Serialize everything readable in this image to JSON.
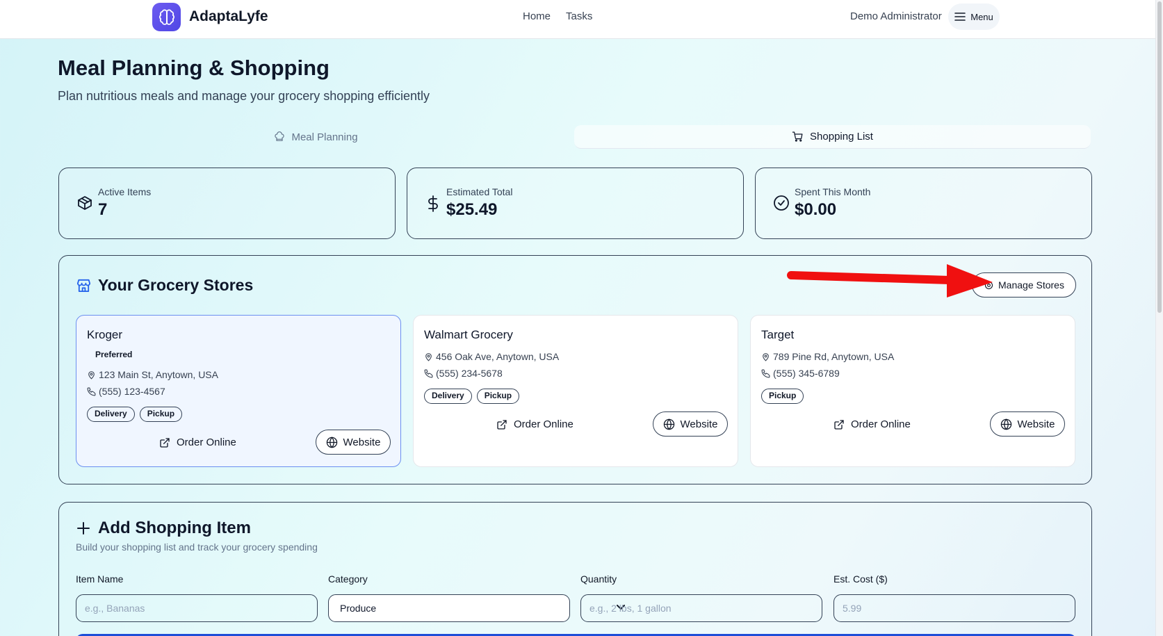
{
  "header": {
    "brand": "AdaptaLyfe",
    "nav": [
      "Home",
      "Tasks"
    ],
    "user": "Demo Administrator",
    "menu_label": "Menu"
  },
  "page": {
    "title": "Meal Planning & Shopping",
    "subtitle": "Plan nutritious meals and manage your grocery shopping efficiently"
  },
  "tabs": [
    {
      "label": "Meal Planning",
      "active": false
    },
    {
      "label": "Shopping List",
      "active": true
    }
  ],
  "stats": [
    {
      "label": "Active Items",
      "value": "7",
      "icon": "package-icon"
    },
    {
      "label": "Estimated Total",
      "value": "$25.49",
      "icon": "dollar-icon"
    },
    {
      "label": "Spent This Month",
      "value": "$0.00",
      "icon": "check-circle-icon"
    }
  ],
  "stores": {
    "title": "Your Grocery Stores",
    "manage_label": "Manage Stores",
    "order_online_label": "Order Online",
    "website_label": "Website",
    "preferred_label": "Preferred",
    "items": [
      {
        "name": "Kroger",
        "preferred": true,
        "address": "123 Main St, Anytown, USA",
        "phone": "(555) 123-4567",
        "tags": [
          "Delivery",
          "Pickup"
        ]
      },
      {
        "name": "Walmart Grocery",
        "preferred": false,
        "address": "456 Oak Ave, Anytown, USA",
        "phone": "(555) 234-5678",
        "tags": [
          "Delivery",
          "Pickup"
        ]
      },
      {
        "name": "Target",
        "preferred": false,
        "address": "789 Pine Rd, Anytown, USA",
        "phone": "(555) 345-6789",
        "tags": [
          "Pickup"
        ]
      }
    ]
  },
  "add_item": {
    "title": "Add Shopping Item",
    "subtitle": "Build your shopping list and track your grocery spending",
    "fields": {
      "item_name": {
        "label": "Item Name",
        "placeholder": "e.g., Bananas"
      },
      "category": {
        "label": "Category",
        "value": "Produce"
      },
      "quantity": {
        "label": "Quantity",
        "placeholder": "e.g., 2 lbs, 1 gallon"
      },
      "cost": {
        "label": "Est. Cost ($)",
        "placeholder": "5.99"
      }
    }
  },
  "colors": {
    "accent": "#1d4ed8",
    "brand": "#5b50ee",
    "annotation_arrow": "#f01010"
  }
}
